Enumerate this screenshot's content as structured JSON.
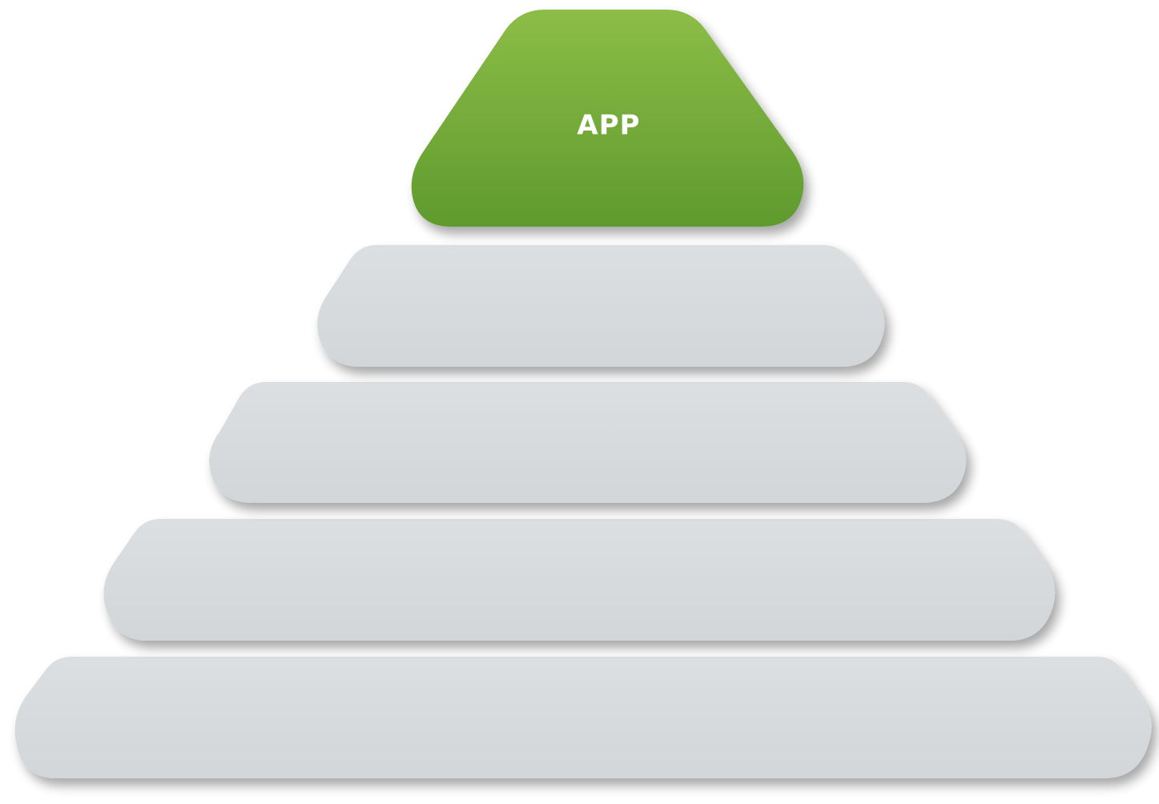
{
  "diagram": {
    "tiers": [
      {
        "label": "APP",
        "color": "#6fa83a",
        "highlighted": true
      },
      {
        "label": "",
        "color": "#d6dadc",
        "highlighted": false
      },
      {
        "label": "",
        "color": "#d6dadc",
        "highlighted": false
      },
      {
        "label": "",
        "color": "#d6dadc",
        "highlighted": false
      },
      {
        "label": "",
        "color": "#d6dadc",
        "highlighted": false
      }
    ]
  }
}
